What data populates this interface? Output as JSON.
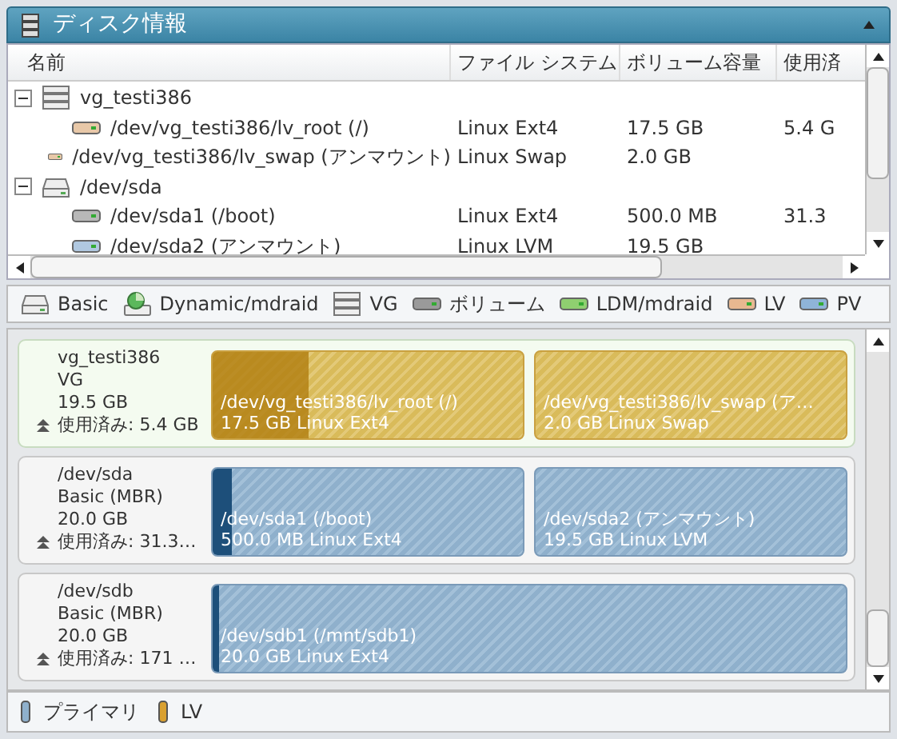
{
  "panel": {
    "title": "ディスク情報",
    "expanded": true
  },
  "tree": {
    "columns": [
      "名前",
      "ファイル システム",
      "ボリューム容量",
      "使用済"
    ],
    "rows": [
      {
        "kind": "vg",
        "name": "vg_testi386",
        "expanded": true,
        "children": [
          {
            "kind": "lv",
            "name": "/dev/vg_testi386/lv_root (/)",
            "filesystem": "Linux Ext4",
            "size": "17.5 GB",
            "used": "5.4 G"
          },
          {
            "kind": "lv",
            "name": "/dev/vg_testi386/lv_swap (アンマウント)",
            "filesystem": "Linux Swap",
            "size": "2.0 GB"
          }
        ]
      },
      {
        "kind": "disk",
        "name": "/dev/sda",
        "expanded": true,
        "children": [
          {
            "kind": "volume",
            "name": "/dev/sda1 (/boot)",
            "filesystem": "Linux Ext4",
            "size": "500.0 MB",
            "used": "31.3"
          },
          {
            "kind": "pv",
            "name": "/dev/sda2 (アンマウント)",
            "filesystem": "Linux LVM",
            "size": "19.5 GB"
          }
        ]
      }
    ]
  },
  "legend": [
    {
      "kind": "disk",
      "label": "Basic"
    },
    {
      "kind": "pie",
      "label": "Dynamic/mdraid"
    },
    {
      "kind": "stack",
      "label": "VG"
    },
    {
      "kind": "bar",
      "label": "ボリューム",
      "color": "#9a9a9a"
    },
    {
      "kind": "bar",
      "label": "LDM/mdraid",
      "color": "#8fcf70"
    },
    {
      "kind": "bar",
      "label": "LV",
      "color": "#e8b890"
    },
    {
      "kind": "bar",
      "label": "PV",
      "color": "#8fb4d8"
    }
  ],
  "disks": [
    {
      "name": "vg_testi386",
      "selected": true,
      "type": "VG",
      "size": "19.5 GB",
      "used": "使用済み: 5.4 GB",
      "partitions": [
        {
          "kind": "lv",
          "name": "/dev/vg_testi386/lv_root (/)",
          "detail": "17.5 GB Linux Ext4",
          "level": 0.31
        },
        {
          "kind": "lv",
          "name": "/dev/vg_testi386/lv_swap (ア…",
          "detail": "2.0 GB Linux Swap"
        }
      ]
    },
    {
      "name": "/dev/sda",
      "selected": false,
      "type": "Basic (MBR)",
      "size": "20.0 GB",
      "used": "使用済み: 31.3…",
      "partitions": [
        {
          "kind": "primary",
          "name": "/dev/sda1 (/boot)",
          "detail": "500.0 MB Linux Ext4",
          "level": 0.06
        },
        {
          "kind": "primary",
          "name": "/dev/sda2 (アンマウント)",
          "detail": "19.5 GB Linux LVM"
        }
      ]
    },
    {
      "name": "/dev/sdb",
      "selected": false,
      "type": "Basic (MBR)",
      "size": "20.0 GB",
      "used": "使用済み: 171 …",
      "partitions": [
        {
          "kind": "primary",
          "name": "/dev/sdb1 (/mnt/sdb1)",
          "detail": "20.0 GB Linux Ext4",
          "level": 0.01
        }
      ]
    }
  ],
  "bottom_legend": [
    {
      "kind": "primary",
      "label": "プライマリ"
    },
    {
      "kind": "lv",
      "label": "LV"
    }
  ]
}
